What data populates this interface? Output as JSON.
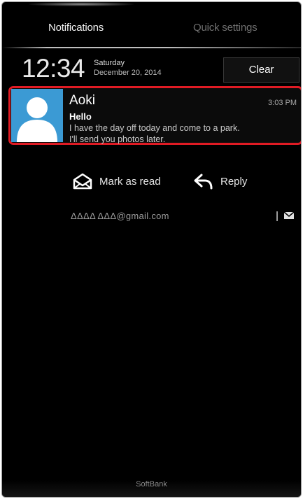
{
  "tabs": {
    "notifications": "Notifications",
    "quick_settings": "Quick settings"
  },
  "clock": {
    "time": "12:34",
    "day": "Saturday",
    "date": "December 20, 2014"
  },
  "clear_label": "Clear",
  "notification": {
    "sender": "Aoki",
    "time": "3:03 PM",
    "subject": "Hello",
    "body_line1": "I have the day off today and come to a park.",
    "body_line2": "I'll send you photos later.",
    "highlight_color": "#e01b24",
    "avatar_color": "#3b9ad4"
  },
  "actions": {
    "mark_as_read": "Mark as read",
    "reply": "Reply"
  },
  "account": "ΔΔΔΔ ΔΔΔ@gmail.com",
  "carrier": "SoftBank",
  "icons": {
    "mark_as_read": "envelope-open-icon",
    "reply": "reply-arrow-icon",
    "account_mail": "mail-icon",
    "avatar": "person-silhouette-icon"
  }
}
